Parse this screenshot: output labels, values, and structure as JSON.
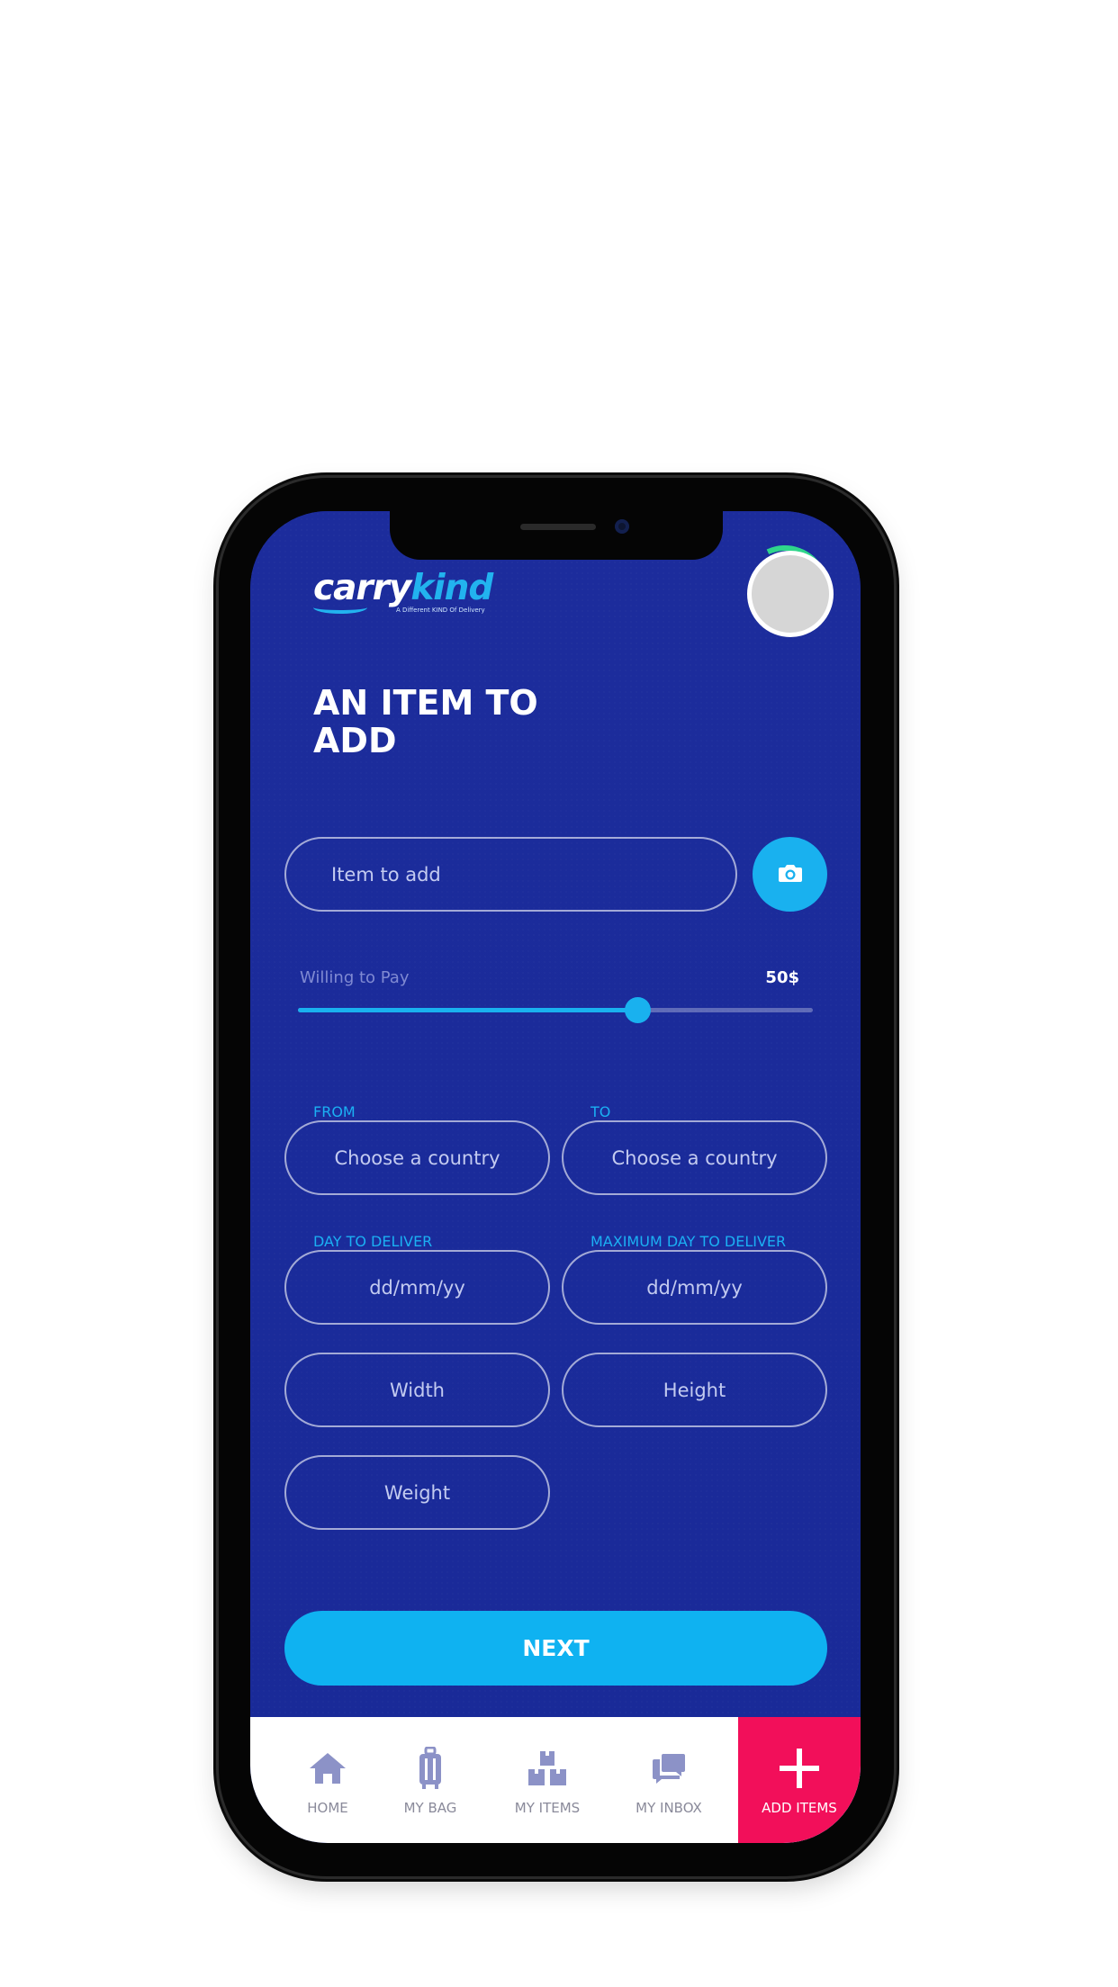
{
  "header": {
    "logo_part1": "carry",
    "logo_part2": "kind",
    "logo_tagline": "A Different KIND Of Delivery",
    "title": "AN ITEM TO ADD"
  },
  "form": {
    "item_placeholder": "Item to add",
    "pay_label": "Willing to Pay",
    "pay_value": "50$",
    "pay_level": 0.66,
    "from_label": "FROM",
    "to_label": "TO",
    "from_placeholder": "Choose a country",
    "to_placeholder": "Choose a country",
    "day_label": "DAY TO DELIVER",
    "max_day_label": "MAXIMUM DAY TO DELIVER",
    "day_placeholder": "dd/mm/yy",
    "max_day_placeholder": "dd/mm/yy",
    "width_placeholder": "Width",
    "height_placeholder": "Height",
    "weight_placeholder": "Weight",
    "next_label": "NEXT"
  },
  "nav": {
    "home": "HOME",
    "bag": "MY BAG",
    "items": "MY ITEMS",
    "inbox": "MY INBOX",
    "add": "ADD ITEMS"
  },
  "icons": {
    "camera": "camera-icon",
    "home": "home-icon",
    "bag": "luggage-icon",
    "items": "boxes-icon",
    "inbox": "chat-icon",
    "add": "plus-icon"
  },
  "colors": {
    "background": "#1a2a9a",
    "accent": "#19b1ef",
    "add_tab": "#f20f5a",
    "avatar_ring": "#2fd68b"
  }
}
